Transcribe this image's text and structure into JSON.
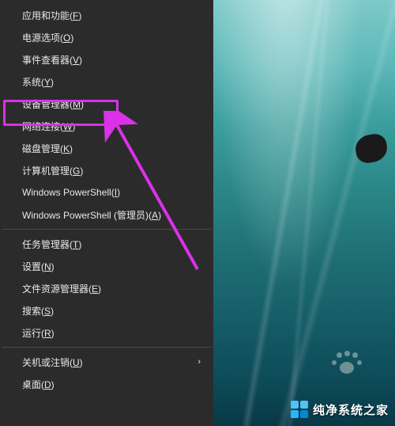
{
  "menu": {
    "groups": [
      {
        "items": [
          {
            "id": "apps-features",
            "text": "应用和功能",
            "accel": "F",
            "submenu": false
          },
          {
            "id": "power-options",
            "text": "电源选项",
            "accel": "O",
            "submenu": false
          },
          {
            "id": "event-viewer",
            "text": "事件查看器",
            "accel": "V",
            "submenu": false
          },
          {
            "id": "system",
            "text": "系统",
            "accel": "Y",
            "submenu": false
          },
          {
            "id": "device-manager",
            "text": "设备管理器",
            "accel": "M",
            "submenu": false,
            "highlighted": true
          },
          {
            "id": "network-connections",
            "text": "网络连接",
            "accel": "W",
            "submenu": false
          },
          {
            "id": "disk-management",
            "text": "磁盘管理",
            "accel": "K",
            "submenu": false
          },
          {
            "id": "computer-management",
            "text": "计算机管理",
            "accel": "G",
            "submenu": false
          },
          {
            "id": "powershell",
            "text": "Windows PowerShell",
            "accel": "I",
            "submenu": false
          },
          {
            "id": "powershell-admin",
            "text": "Windows PowerShell (管理员)",
            "accel": "A",
            "submenu": false
          }
        ]
      },
      {
        "items": [
          {
            "id": "task-manager",
            "text": "任务管理器",
            "accel": "T",
            "submenu": false
          },
          {
            "id": "settings",
            "text": "设置",
            "accel": "N",
            "submenu": false
          },
          {
            "id": "file-explorer",
            "text": "文件资源管理器",
            "accel": "E",
            "submenu": false
          },
          {
            "id": "search",
            "text": "搜索",
            "accel": "S",
            "submenu": false
          },
          {
            "id": "run",
            "text": "运行",
            "accel": "R",
            "submenu": false
          }
        ]
      },
      {
        "items": [
          {
            "id": "shutdown-signout",
            "text": "关机或注销",
            "accel": "U",
            "submenu": true
          },
          {
            "id": "desktop",
            "text": "桌面",
            "accel": "D",
            "submenu": false
          }
        ]
      }
    ]
  },
  "annotation": {
    "highlight_color": "#d932e8",
    "arrow_color": "#d932e8"
  },
  "watermark": {
    "text": "纯净系统之家"
  }
}
